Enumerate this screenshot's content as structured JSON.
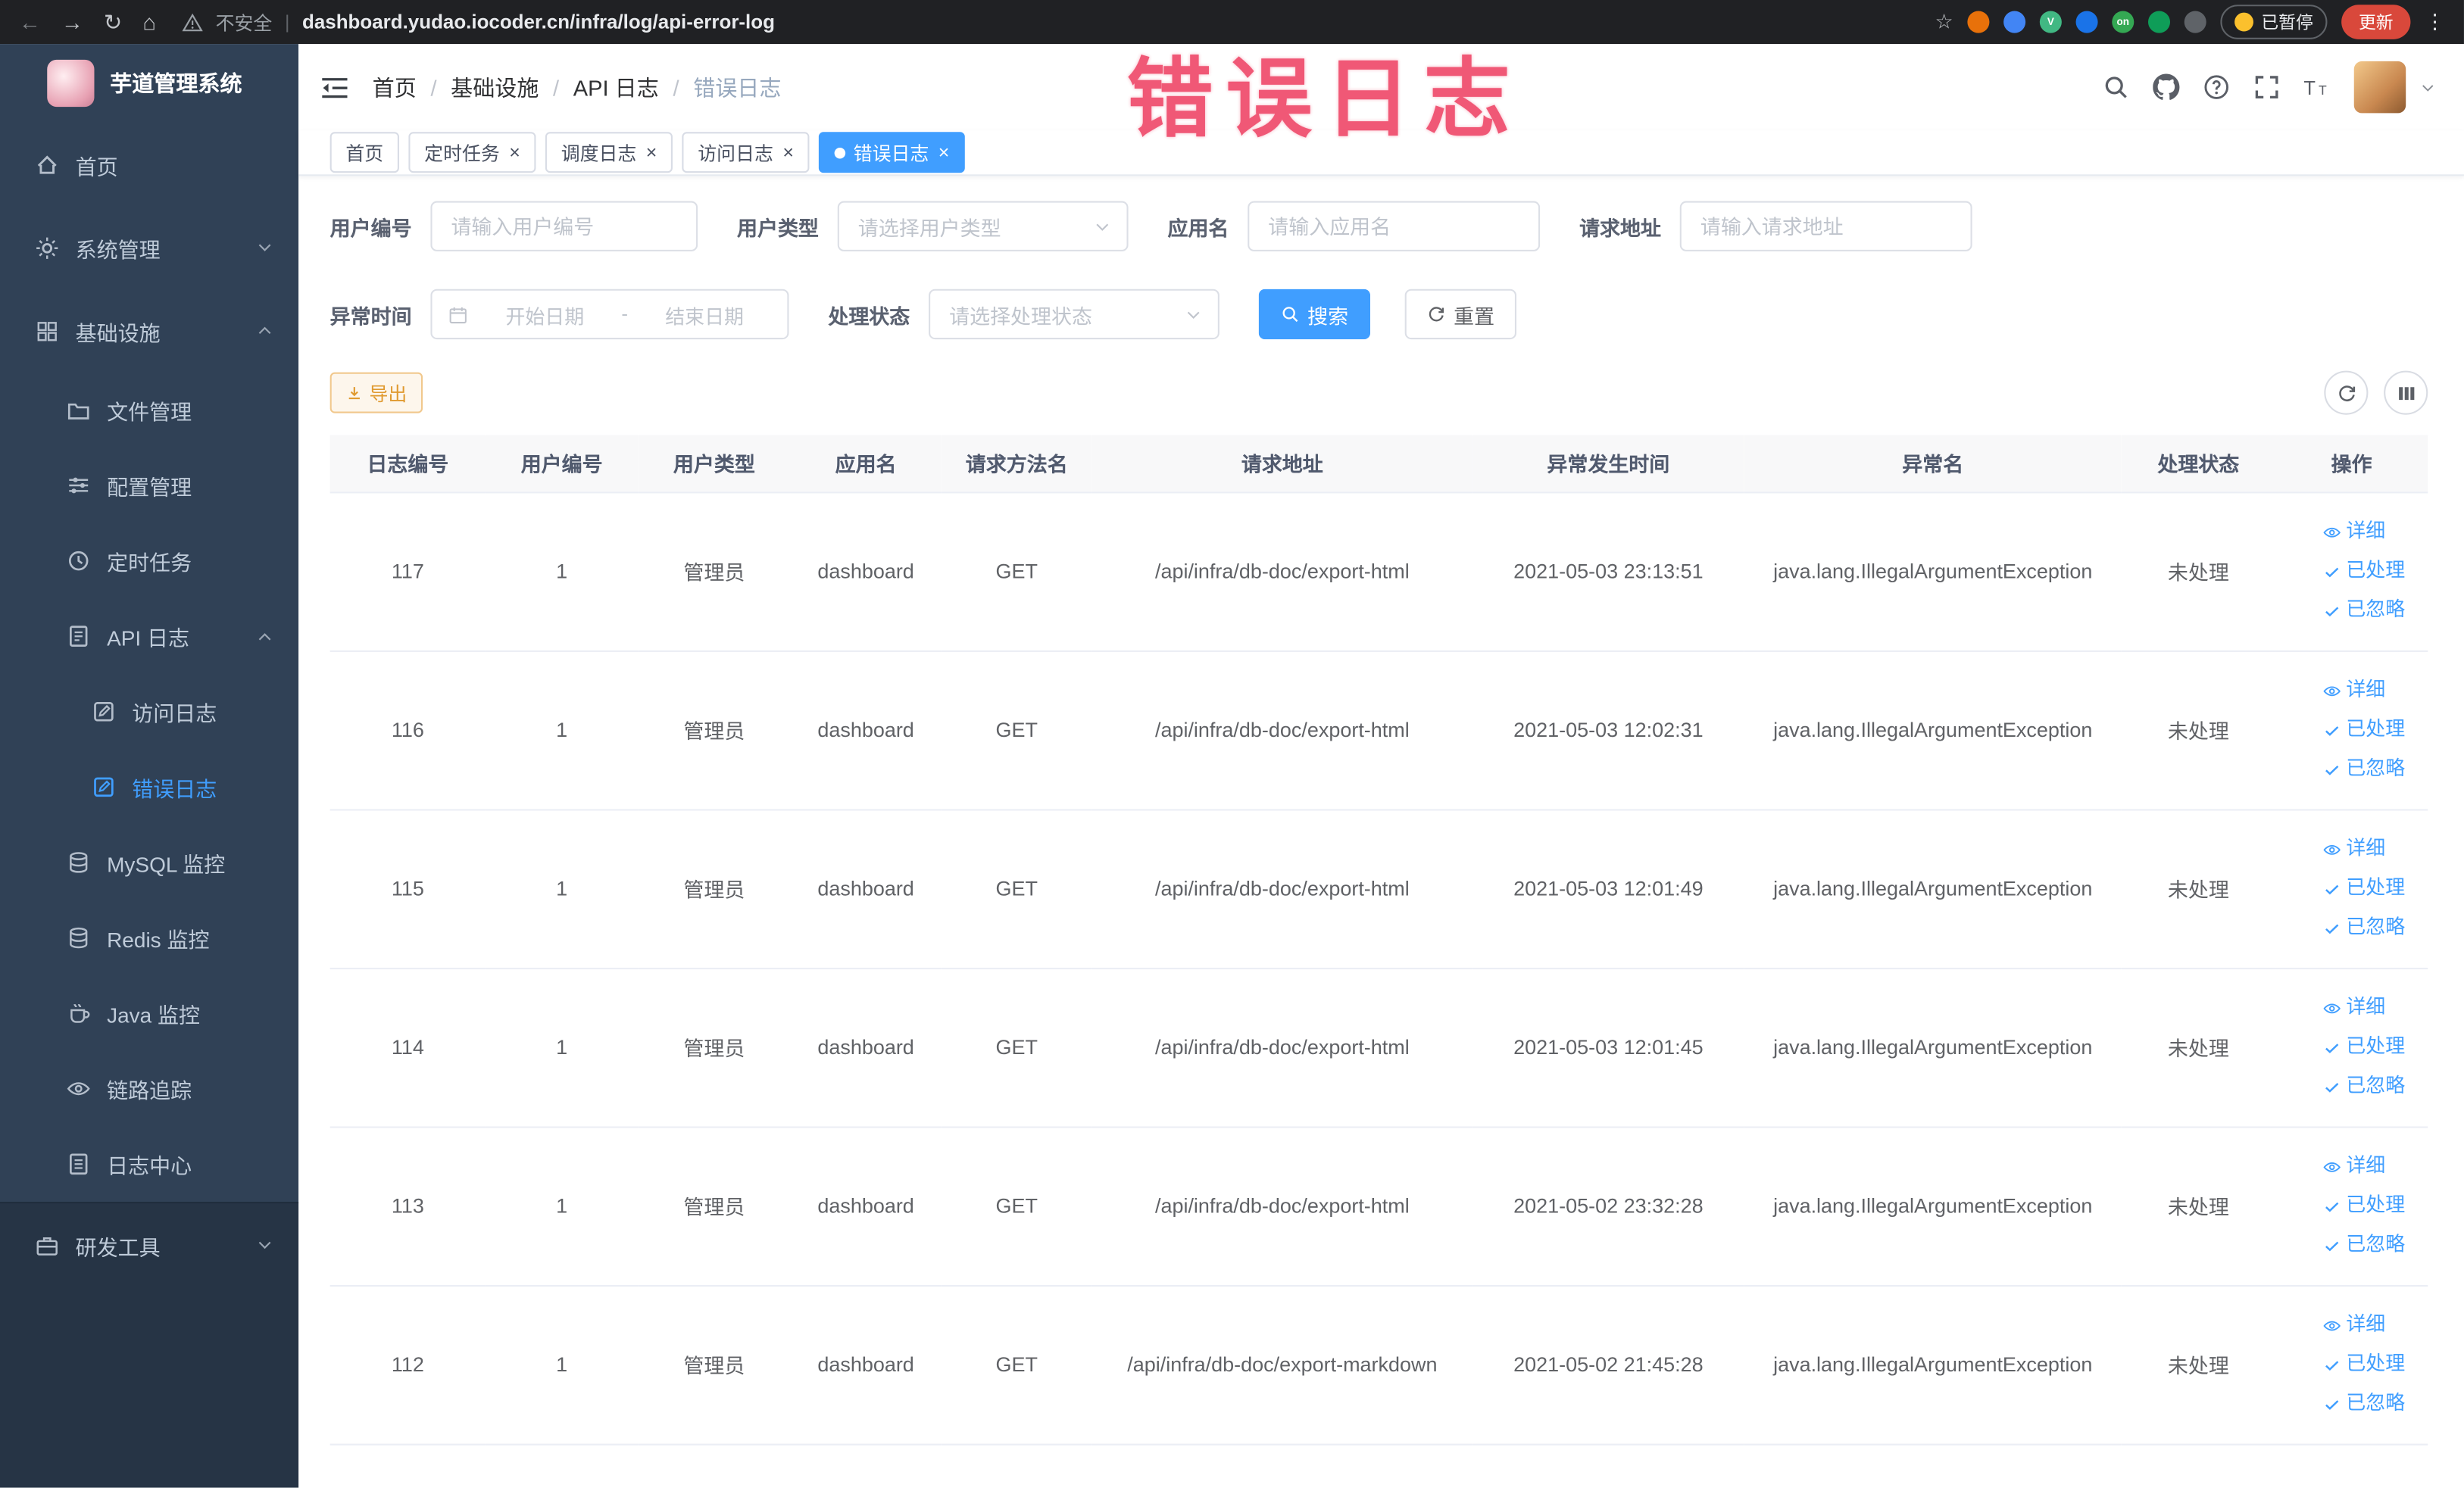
{
  "browser_chrome": {
    "security_label": "不安全",
    "url": "dashboard.yudao.iocoder.cn/infra/log/api-error-log",
    "paused_badge": "已暂停",
    "update_button": "更新",
    "extensions": [
      {
        "id": "extension-1",
        "color": "#e8710a",
        "glyph": ""
      },
      {
        "id": "extension-2",
        "color": "#4285f4",
        "glyph": ""
      },
      {
        "id": "extension-3",
        "color": "#41b883",
        "glyph": "V"
      },
      {
        "id": "extension-4",
        "color": "#1a73e8",
        "glyph": ""
      },
      {
        "id": "extension-5",
        "color": "#34a853",
        "glyph": "on"
      },
      {
        "id": "extension-6",
        "color": "#0f9d58",
        "glyph": ""
      },
      {
        "id": "extension-7",
        "color": "#5f6368",
        "glyph": ""
      }
    ]
  },
  "annotation": {
    "text": "错误日志",
    "color": "#ef4a6b"
  },
  "sidebar": {
    "logo_title": "芋道管理系统",
    "items": [
      {
        "id": "home",
        "label": "首页",
        "level": 0,
        "icon": "home-icon"
      },
      {
        "id": "system",
        "label": "系统管理",
        "level": 0,
        "icon": "gear-icon",
        "chevron": "down"
      },
      {
        "id": "infra",
        "label": "基础设施",
        "level": 0,
        "icon": "grid-icon",
        "chevron": "up"
      },
      {
        "id": "file",
        "label": "文件管理",
        "level": 1,
        "icon": "folder-icon"
      },
      {
        "id": "config",
        "label": "配置管理",
        "level": 1,
        "icon": "config-icon"
      },
      {
        "id": "job",
        "label": "定时任务",
        "level": 1,
        "icon": "clock-icon"
      },
      {
        "id": "api-log",
        "label": "API 日志",
        "level": 1,
        "icon": "log-icon",
        "chevron": "up"
      },
      {
        "id": "access-log",
        "label": "访问日志",
        "level": 2,
        "icon": "doc-edit-icon"
      },
      {
        "id": "error-log",
        "label": "错误日志",
        "level": 2,
        "icon": "doc-edit-icon",
        "active": true
      },
      {
        "id": "mysql",
        "label": "MySQL 监控",
        "level": 1,
        "icon": "database-icon"
      },
      {
        "id": "redis",
        "label": "Redis 监控",
        "level": 1,
        "icon": "database-icon"
      },
      {
        "id": "java",
        "label": "Java 监控",
        "level": 1,
        "icon": "coffee-icon"
      },
      {
        "id": "trace",
        "label": "链路追踪",
        "level": 1,
        "icon": "eye-icon"
      },
      {
        "id": "log-center",
        "label": "日志中心",
        "level": 1,
        "icon": "doc-icon"
      },
      {
        "id": "devtools",
        "label": "研发工具",
        "level": 0,
        "icon": "briefcase-icon",
        "chevron": "down",
        "section": "footer"
      }
    ]
  },
  "header": {
    "breadcrumb": [
      "首页",
      "基础设施",
      "API 日志",
      "错误日志"
    ]
  },
  "tabs": [
    {
      "id": "home",
      "label": "首页",
      "closable": false,
      "active": false
    },
    {
      "id": "job",
      "label": "定时任务",
      "closable": true,
      "active": false
    },
    {
      "id": "job-log",
      "label": "调度日志",
      "closable": true,
      "active": false
    },
    {
      "id": "access-log",
      "label": "访问日志",
      "closable": true,
      "active": false
    },
    {
      "id": "error-log",
      "label": "错误日志",
      "closable": true,
      "active": true
    }
  ],
  "filters": {
    "user_id": {
      "label": "用户编号",
      "placeholder": "请输入用户编号"
    },
    "user_type": {
      "label": "用户类型",
      "placeholder": "请选择用户类型"
    },
    "app_name": {
      "label": "应用名",
      "placeholder": "请输入应用名"
    },
    "request_url": {
      "label": "请求地址",
      "placeholder": "请输入请求地址"
    },
    "exception_time": {
      "label": "异常时间",
      "start_placeholder": "开始日期",
      "separator": "-",
      "end_placeholder": "结束日期"
    },
    "process_status": {
      "label": "处理状态",
      "placeholder": "请选择处理状态"
    },
    "search_label": "搜索",
    "reset_label": "重置"
  },
  "toolbar": {
    "export_label": "导出"
  },
  "table": {
    "columns": [
      "日志编号",
      "用户编号",
      "用户类型",
      "应用名",
      "请求方法名",
      "请求地址",
      "异常发生时间",
      "异常名",
      "处理状态",
      "操作"
    ],
    "row_actions": [
      {
        "id": "detail",
        "label": "详细",
        "icon": "eye-icon"
      },
      {
        "id": "processed",
        "label": "已处理",
        "icon": "check-icon"
      },
      {
        "id": "ignored",
        "label": "已忽略",
        "icon": "check-icon"
      }
    ],
    "rows": [
      {
        "log_id": "117",
        "user_id": "1",
        "user_type": "管理员",
        "app_name": "dashboard",
        "method": "GET",
        "url": "/api/infra/db-doc/export-html",
        "time": "2021-05-03 23:13:51",
        "exception": "java.lang.IllegalArgumentException",
        "status": "未处理"
      },
      {
        "log_id": "116",
        "user_id": "1",
        "user_type": "管理员",
        "app_name": "dashboard",
        "method": "GET",
        "url": "/api/infra/db-doc/export-html",
        "time": "2021-05-03 12:02:31",
        "exception": "java.lang.IllegalArgumentException",
        "status": "未处理"
      },
      {
        "log_id": "115",
        "user_id": "1",
        "user_type": "管理员",
        "app_name": "dashboard",
        "method": "GET",
        "url": "/api/infra/db-doc/export-html",
        "time": "2021-05-03 12:01:49",
        "exception": "java.lang.IllegalArgumentException",
        "status": "未处理"
      },
      {
        "log_id": "114",
        "user_id": "1",
        "user_type": "管理员",
        "app_name": "dashboard",
        "method": "GET",
        "url": "/api/infra/db-doc/export-html",
        "time": "2021-05-03 12:01:45",
        "exception": "java.lang.IllegalArgumentException",
        "status": "未处理"
      },
      {
        "log_id": "113",
        "user_id": "1",
        "user_type": "管理员",
        "app_name": "dashboard",
        "method": "GET",
        "url": "/api/infra/db-doc/export-html",
        "time": "2021-05-02 23:32:28",
        "exception": "java.lang.IllegalArgumentException",
        "status": "未处理"
      },
      {
        "log_id": "112",
        "user_id": "1",
        "user_type": "管理员",
        "app_name": "dashboard",
        "method": "GET",
        "url": "/api/infra/db-doc/export-markdown",
        "time": "2021-05-02 21:45:28",
        "exception": "java.lang.IllegalArgumentException",
        "status": "未处理"
      }
    ]
  }
}
